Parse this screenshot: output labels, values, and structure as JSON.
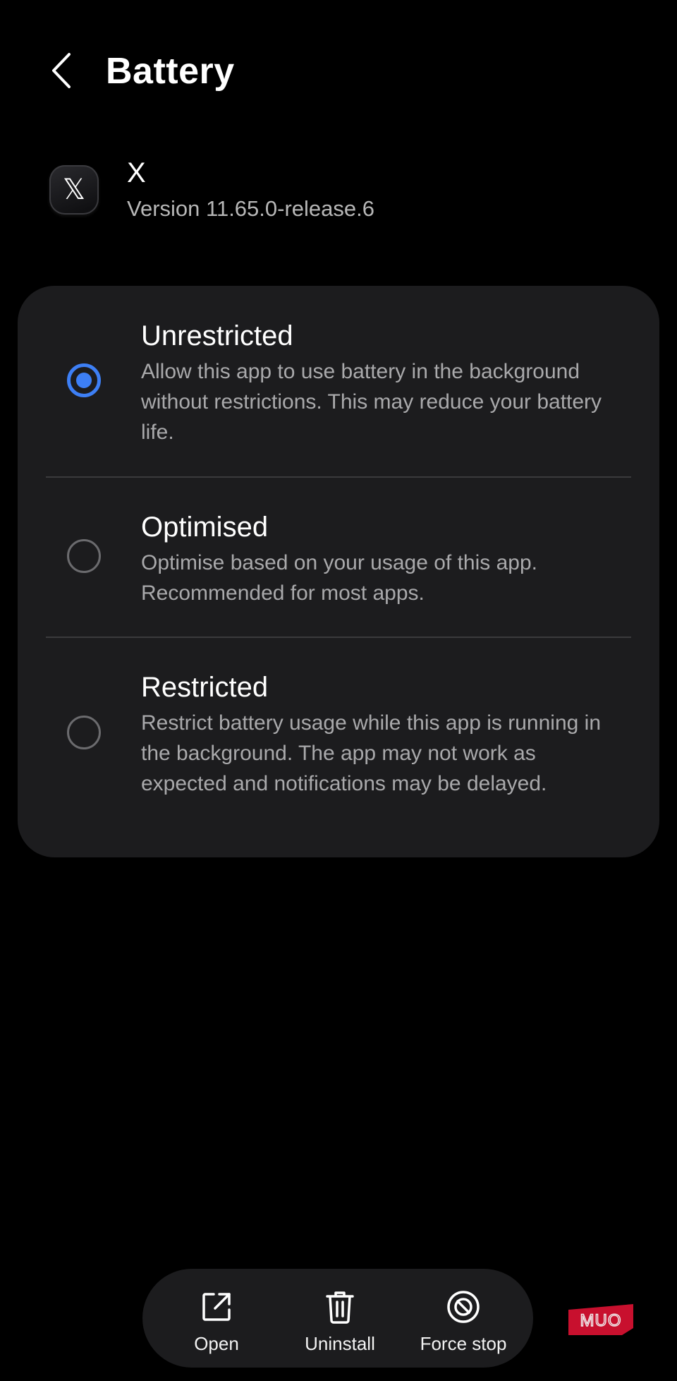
{
  "header": {
    "title": "Battery",
    "back_icon": "chevron-left-icon"
  },
  "app": {
    "name": "X",
    "version": "Version 11.65.0-release.6",
    "icon": "x-logo-icon",
    "icon_glyph": "𝕏"
  },
  "battery_options": {
    "selected": "unrestricted",
    "accent_color": "#3d7ff5",
    "items": [
      {
        "id": "unrestricted",
        "title": "Unrestricted",
        "description": "Allow this app to use battery in the background without restrictions. This may reduce your battery life.",
        "checked": true
      },
      {
        "id": "optimised",
        "title": "Optimised",
        "description": "Optimise based on your usage of this app. Recommended for most apps.",
        "checked": false
      },
      {
        "id": "restricted",
        "title": "Restricted",
        "description": "Restrict battery usage while this app is running in the background. The app may not work as expected and notifications may be delayed.",
        "checked": false
      }
    ]
  },
  "bottom_actions": [
    {
      "label": "Open",
      "icon": "open-external-icon"
    },
    {
      "label": "Uninstall",
      "icon": "trash-icon"
    },
    {
      "label": "Force stop",
      "icon": "block-icon"
    }
  ],
  "watermark": {
    "text": "MUO",
    "color": "#c8102e"
  }
}
